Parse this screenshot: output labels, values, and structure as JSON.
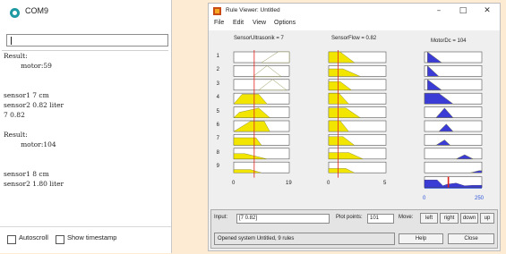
{
  "serial_monitor": {
    "title": "COM9",
    "icon": "arduino-serial-icon",
    "send_input_value": "",
    "output_lines": [
      "Result:",
      "        motor:59",
      "",
      "",
      "sensor1 7 cm",
      "sensor2 0.82 liter",
      "7 0.82",
      "",
      "Result:",
      "        motor:104",
      "",
      "",
      "sensor1 8 cm",
      "sensor2 1.80 liter"
    ],
    "autoscroll_label": "Autoscroll",
    "timestamp_label": "Show timestamp",
    "autoscroll_checked": false,
    "timestamp_checked": false
  },
  "rule_viewer": {
    "title": "Rule Viewer: Untitled",
    "window_buttons": {
      "minimize": "–",
      "maximize": "□",
      "close": "✕"
    },
    "menu": [
      "File",
      "Edit",
      "View",
      "Options"
    ],
    "columns": [
      {
        "header": "SensorUltrasonik = 7",
        "axis_min": "0",
        "axis_max": "19",
        "value": 7,
        "range": [
          0,
          19
        ]
      },
      {
        "header": "SensorFlow = 0.82",
        "axis_min": "0",
        "axis_max": "5",
        "value": 0.82,
        "range": [
          0,
          5
        ]
      },
      {
        "header": "MotorDc = 104",
        "axis_min": "0",
        "axis_max": "250",
        "value": 104,
        "range": [
          0,
          250
        ]
      }
    ],
    "rule_numbers": [
      "1",
      "2",
      "3",
      "4",
      "5",
      "6",
      "7",
      "8",
      "9"
    ],
    "input_label": "Input:",
    "input_value": "[7 0.82]",
    "plot_points_label": "Plot points:",
    "plot_points_value": "101",
    "move_label": "Move:",
    "move_buttons": [
      "left",
      "right",
      "down",
      "up"
    ],
    "status_text": "Opened system Untitled, 9 rules",
    "help_label": "Help",
    "close_label": "Close",
    "colors": {
      "input_fill": "#f2e600",
      "output_fill": "#3b3bd6",
      "indicator": "#e0201b",
      "mf_line": "#c9c97a"
    }
  }
}
